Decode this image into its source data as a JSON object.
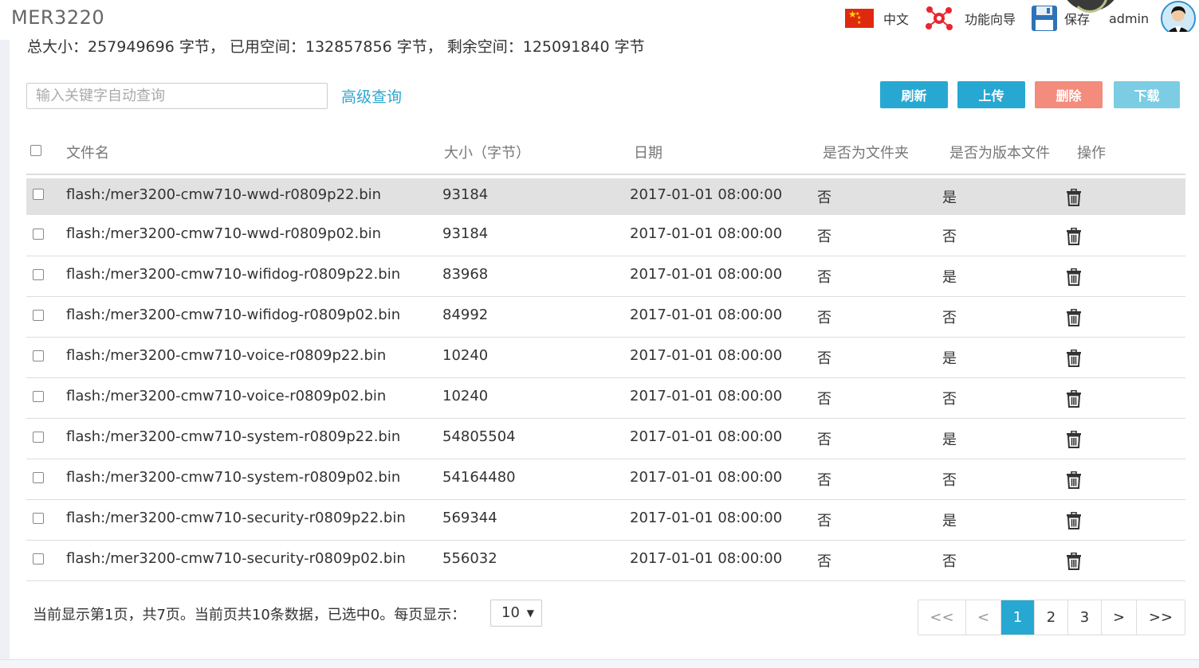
{
  "header": {
    "app_title": "MER3220",
    "language_label": "中文",
    "wizard_label": "功能向导",
    "save_label": "保存",
    "user_label": "admin"
  },
  "stats_text": "总大小：257949696 字节， 已用空间：132857856 字节， 剩余空间：125091840 字节",
  "toolbar": {
    "search_placeholder": "输入关键字自动查询",
    "advanced_search_label": "高级查询",
    "refresh_label": "刷新",
    "upload_label": "上传",
    "delete_label": "删除",
    "download_label": "下载"
  },
  "table": {
    "columns": [
      "文件名",
      "大小（字节）",
      "日期",
      "是否为文件夹",
      "是否为版本文件",
      "操作"
    ],
    "rows": [
      {
        "name": "flash:/mer3200-cmw710-wwd-r0809p22.bin",
        "size": "93184",
        "date": "2017-01-01 08:00:00",
        "is_folder": "否",
        "is_version": "是"
      },
      {
        "name": "flash:/mer3200-cmw710-wwd-r0809p02.bin",
        "size": "93184",
        "date": "2017-01-01 08:00:00",
        "is_folder": "否",
        "is_version": "否"
      },
      {
        "name": "flash:/mer3200-cmw710-wifidog-r0809p22.bin",
        "size": "83968",
        "date": "2017-01-01 08:00:00",
        "is_folder": "否",
        "is_version": "是"
      },
      {
        "name": "flash:/mer3200-cmw710-wifidog-r0809p02.bin",
        "size": "84992",
        "date": "2017-01-01 08:00:00",
        "is_folder": "否",
        "is_version": "否"
      },
      {
        "name": "flash:/mer3200-cmw710-voice-r0809p22.bin",
        "size": "10240",
        "date": "2017-01-01 08:00:00",
        "is_folder": "否",
        "is_version": "是"
      },
      {
        "name": "flash:/mer3200-cmw710-voice-r0809p02.bin",
        "size": "10240",
        "date": "2017-01-01 08:00:00",
        "is_folder": "否",
        "is_version": "否"
      },
      {
        "name": "flash:/mer3200-cmw710-system-r0809p22.bin",
        "size": "54805504",
        "date": "2017-01-01 08:00:00",
        "is_folder": "否",
        "is_version": "是"
      },
      {
        "name": "flash:/mer3200-cmw710-system-r0809p02.bin",
        "size": "54164480",
        "date": "2017-01-01 08:00:00",
        "is_folder": "否",
        "is_version": "否"
      },
      {
        "name": "flash:/mer3200-cmw710-security-r0809p22.bin",
        "size": "569344",
        "date": "2017-01-01 08:00:00",
        "is_folder": "否",
        "is_version": "是"
      },
      {
        "name": "flash:/mer3200-cmw710-security-r0809p02.bin",
        "size": "556032",
        "date": "2017-01-01 08:00:00",
        "is_folder": "否",
        "is_version": "否"
      }
    ],
    "row_action_icon": "trash-icon"
  },
  "footer": {
    "pager_info": "当前显示第1页，共7页。当前页共10条数据，已选中0。每页显示：",
    "page_size": "10",
    "pagination": {
      "first": "<<",
      "prev": "<",
      "pages": [
        "1",
        "2",
        "3"
      ],
      "current": "1",
      "next": ">",
      "last": ">>"
    }
  },
  "colors": {
    "accent": "#27a8d2",
    "danger": "#f38c7c",
    "disabled_accent": "#7ccde3",
    "link": "#2ea6cf",
    "selected_row": "#e1e1e1"
  }
}
